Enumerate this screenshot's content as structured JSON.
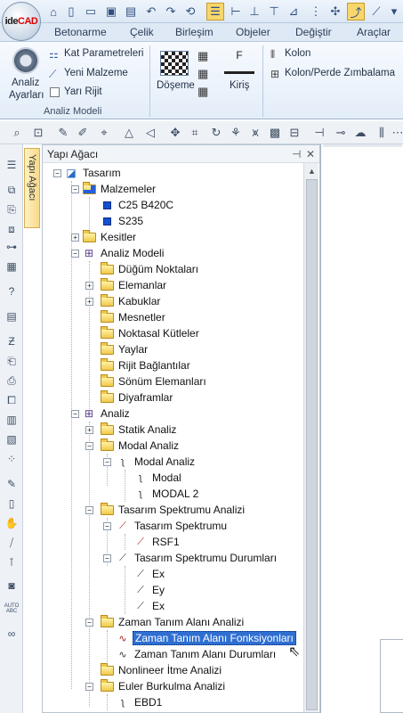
{
  "app": {
    "logo_text_a": "ide",
    "logo_text_b": "CAD"
  },
  "ribbon_tabs": [
    "Betonarme",
    "Çelik",
    "Birleşim",
    "Objeler",
    "Değiştir",
    "Araçlar"
  ],
  "ribbon": {
    "analiz_ayarlari_line1": "Analiz",
    "analiz_ayarlari_line2": "Ayarları",
    "kat_parametreleri": "Kat Parametreleri",
    "yeni_malzeme": "Yeni Malzeme",
    "yari_rijit": "Yarı Rijit",
    "group_label": "Analiz Modeli",
    "doseme": "Döşeme",
    "kiris": "Kiriş",
    "kolon": "Kolon",
    "kolon_perde": "Kolon/Perde Zımbalama"
  },
  "panel": {
    "title": "Yapı Ağacı",
    "pin": "⊣",
    "close": "✕",
    "side_tab": "Yapı Ağacı"
  },
  "tree": {
    "tasarim": "Tasarım",
    "malzemeler": "Malzemeler",
    "c25": "C25 B420C",
    "s235": "S235",
    "kesitler": "Kesitler",
    "analiz_modeli": "Analiz Modeli",
    "dugum": "Düğüm Noktaları",
    "elemanlar": "Elemanlar",
    "kabuklar": "Kabuklar",
    "mesnetler": "Mesnetler",
    "noktasal": "Noktasal Kütleler",
    "yaylar": "Yaylar",
    "rijit": "Rijit Bağlantılar",
    "sonum": "Sönüm Elemanları",
    "diyafram": "Diyaframlar",
    "analiz": "Analiz",
    "statik": "Statik Analiz",
    "modal_analiz_folder": "Modal Analiz",
    "modal_analiz": "Modal Analiz",
    "modal": "Modal",
    "modal2": "MODAL 2",
    "tsa": "Tasarım Spektrumu Analizi",
    "ts": "Tasarım Spektrumu",
    "rsf1": "RSF1",
    "tsd": "Tasarım Spektrumu Durumları",
    "ex1": "Ex",
    "ey": "Ey",
    "ex2": "Ex",
    "zta": "Zaman Tanım Alanı Analizi",
    "ztaf": "Zaman Tanım Alanı Fonksiyonları",
    "ztad": "Zaman Tanım Alanı Durumları",
    "nonlineer": "Nonlineer İtme Analizi",
    "euler": "Euler Burkulma Analizi",
    "ebd1": "EBD1"
  },
  "colors": {
    "selection": "#2f6fd2",
    "accent": "#f8d66c",
    "ribbon_bg": "#e3edf8"
  }
}
